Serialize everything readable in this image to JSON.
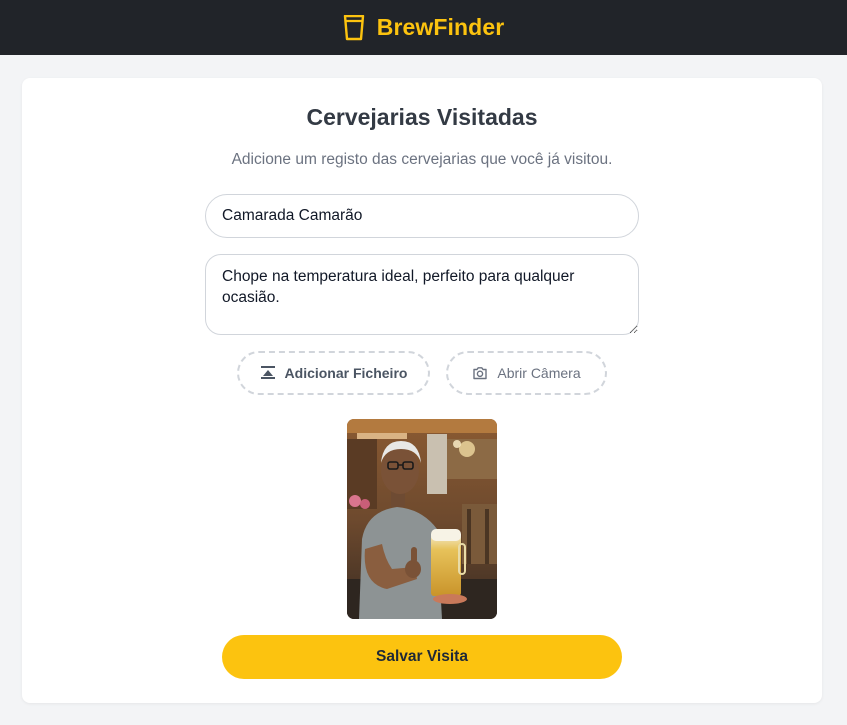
{
  "app": {
    "name": "BrewFinder",
    "brand_icon": "beer-glass-icon",
    "accent_color": "#fcc30f",
    "header_color": "#212429"
  },
  "form": {
    "title": "Cervejarias Visitadas",
    "subtitle": "Adicione um registo das cervejarias que você já visitou.",
    "brewery_name_value": "Camarada Camarão",
    "notes_value": "Chope na temperatura ideal, perfeito para qualquer ocasião.",
    "add_file_label": "Adicionar Ficheiro",
    "add_file_icon": "upload-icon",
    "open_camera_label": "Abrir Câmera",
    "open_camera_icon": "camera-icon",
    "photo_icon": "photo-preview",
    "save_label": "Salvar Visita"
  }
}
